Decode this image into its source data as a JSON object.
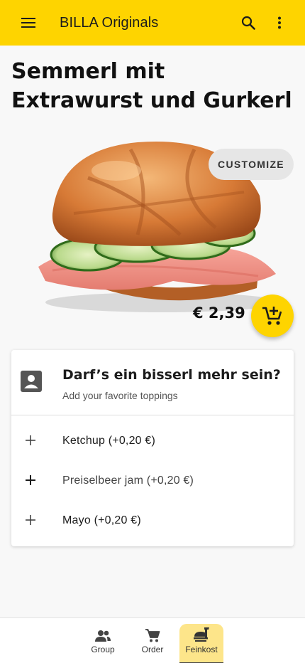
{
  "app_bar": {
    "title": "BILLA Originals",
    "menu_icon": "menu-icon",
    "search_icon": "search-icon",
    "more_icon": "more-vert-icon",
    "color": "#fed400"
  },
  "product": {
    "title": "Semmerl mit Extrawurst und Gurkerl",
    "customize_label": "CUSTOMIZE",
    "price": "€ 2,39",
    "add_to_cart_icon": "add-to-cart-icon"
  },
  "toppings": {
    "title": "Darf’s ein bisserl mehr sein?",
    "subtitle": "Add your favorite toppings",
    "icon": "contact-card-icon",
    "options": [
      {
        "label": "Ketchup (+0,20 €)"
      },
      {
        "label": "Preiselbeer jam (+0,20 €)"
      },
      {
        "label": "Mayo (+0,20 €)"
      }
    ]
  },
  "bottom_nav": {
    "items": [
      {
        "label": "Group",
        "icon": "group-icon",
        "active": false
      },
      {
        "label": "Order",
        "icon": "cart-icon",
        "active": false
      },
      {
        "label": "Feinkost",
        "icon": "food-icon",
        "active": true
      }
    ]
  }
}
